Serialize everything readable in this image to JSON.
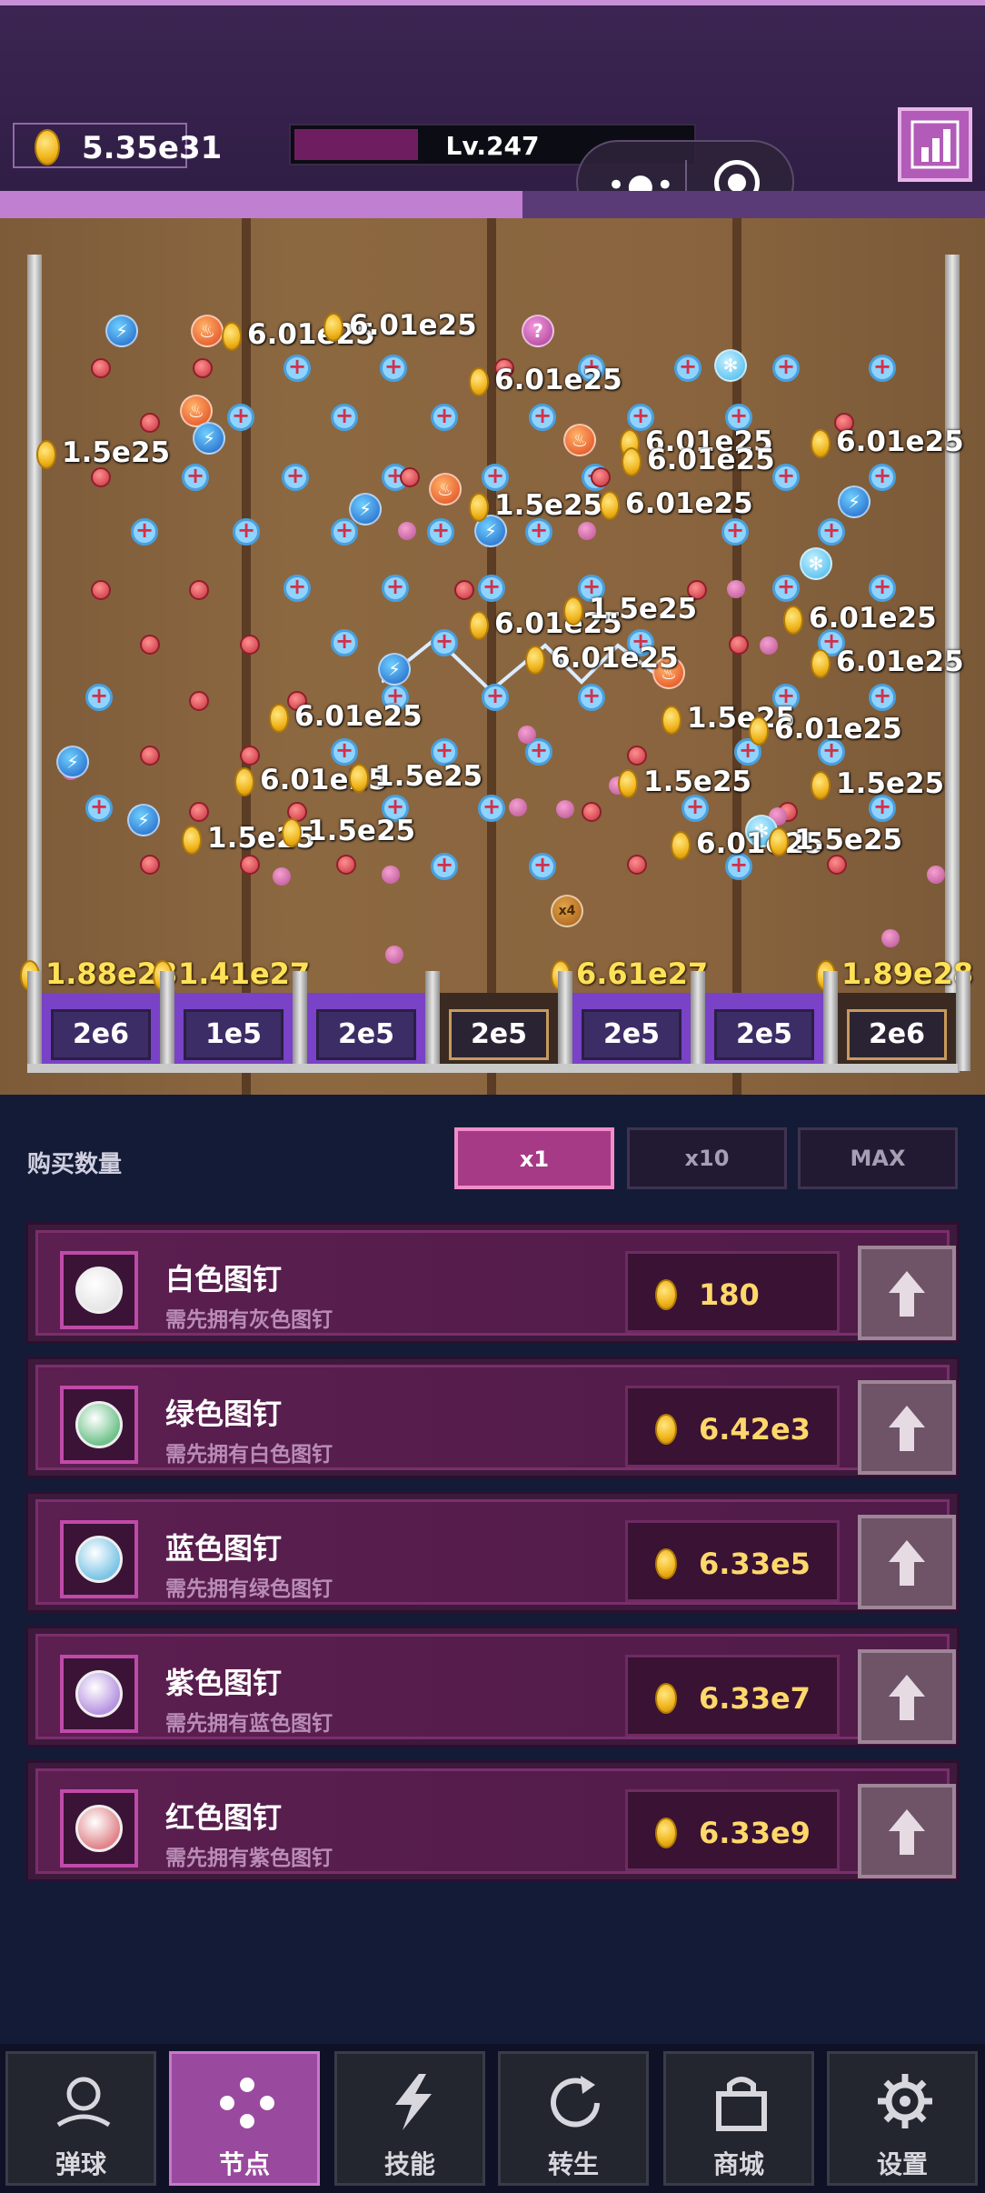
{
  "header": {
    "coins_total": "5.35e31",
    "level_label": "Lv.247",
    "level_progress": 0.31,
    "exp_progress": 0.53,
    "capsule_dots": "•●•"
  },
  "board": {
    "floating_values": [
      {
        "text": "6.01e25"
      },
      {
        "text": "6.01e25"
      },
      {
        "text": "6.01e25"
      },
      {
        "text": "1.5e25"
      },
      {
        "text": "6.01e25"
      },
      {
        "text": "6.01e25"
      },
      {
        "text": "6.01e25"
      },
      {
        "text": "1.5e25"
      },
      {
        "text": "6.01e25"
      },
      {
        "text": "6.01e25"
      },
      {
        "text": "1.5e25"
      },
      {
        "text": "6.01e25"
      },
      {
        "text": "6.01e25"
      },
      {
        "text": "6.01e25"
      },
      {
        "text": "6.01e25"
      },
      {
        "text": "1.5e25"
      },
      {
        "text": "6.01e25"
      },
      {
        "text": "1.5e25"
      },
      {
        "text": "6.01e25"
      },
      {
        "text": "1.5e25"
      },
      {
        "text": "1.5e25"
      },
      {
        "text": "1.5e25"
      },
      {
        "text": "1.5e25"
      },
      {
        "text": "6.01e25"
      },
      {
        "text": "1.5e25"
      }
    ],
    "x4_label": "x4",
    "bucket_values": [
      "1.88e28",
      "1.41e27",
      "6.61e27",
      "1.89e28"
    ],
    "buckets": [
      "2e6",
      "1e5",
      "2e5",
      "2e5",
      "2e5",
      "2e5",
      "2e6"
    ]
  },
  "shop": {
    "qty_label": "购买数量",
    "qty_options": [
      "x1",
      "x10",
      "MAX"
    ],
    "qty_selected": "x1",
    "items": [
      {
        "title": "白色图钉",
        "sub": "需先拥有灰色图钉",
        "price": "180",
        "ball_color": "#e6e6e6"
      },
      {
        "title": "绿色图钉",
        "sub": "需先拥有白色图钉",
        "price": "6.42e3",
        "ball_color": "#6fc28b"
      },
      {
        "title": "蓝色图钉",
        "sub": "需先拥有绿色图钉",
        "price": "6.33e5",
        "ball_color": "#7cc4e6"
      },
      {
        "title": "紫色图钉",
        "sub": "需先拥有蓝色图钉",
        "price": "6.33e7",
        "ball_color": "#b794e0"
      },
      {
        "title": "红色图钉",
        "sub": "需先拥有紫色图钉",
        "price": "6.33e9",
        "ball_color": "#e0858a"
      }
    ]
  },
  "nav": {
    "items": [
      {
        "label": "弹球",
        "icon": "pinball-icon"
      },
      {
        "label": "节点",
        "icon": "nodes-icon"
      },
      {
        "label": "技能",
        "icon": "lightning-icon"
      },
      {
        "label": "转生",
        "icon": "rebirth-icon"
      },
      {
        "label": "商城",
        "icon": "shop-bag-icon"
      },
      {
        "label": "设置",
        "icon": "gear-icon"
      }
    ],
    "active": "节点"
  },
  "colors": {
    "accent": "#a63a86",
    "coin": "#f0b51d",
    "board": "#8c6841",
    "bg": "#141b36"
  }
}
